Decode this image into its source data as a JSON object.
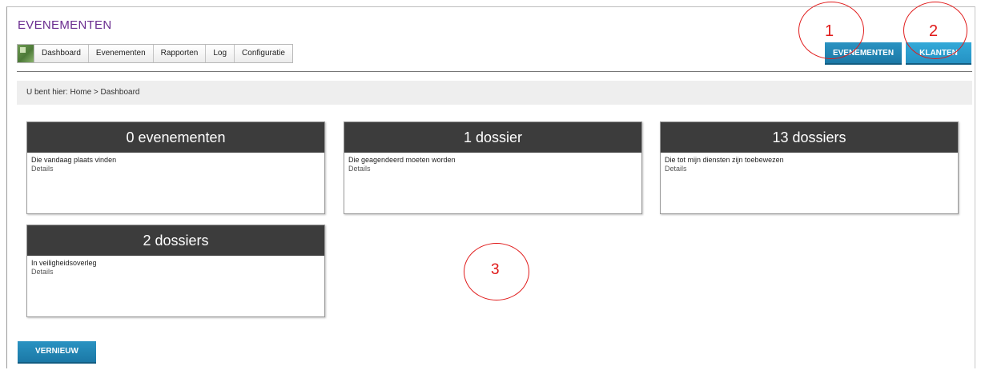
{
  "app_title": "EVENEMENTEN",
  "menu": {
    "items": [
      "Dashboard",
      "Evenementen",
      "Rapporten",
      "Log",
      "Configuratie"
    ]
  },
  "header_buttons": {
    "evenementen": "EVENEMENTEN",
    "klanten": "KLANTEN"
  },
  "breadcrumb": "U bent hier: Home > Dashboard",
  "cards": [
    {
      "title": "0 evenementen",
      "description": "Die vandaag plaats vinden",
      "link": "Details"
    },
    {
      "title": "1 dossier",
      "description": "Die geagendeerd moeten worden",
      "link": "Details"
    },
    {
      "title": "13 dossiers",
      "description": "Die tot mijn diensten zijn toebewezen",
      "link": "Details"
    },
    {
      "title": "2 dossiers",
      "description": "In veiligheidsoverleg",
      "link": "Details"
    }
  ],
  "refresh_button": "VERNIEUW",
  "annotations": [
    "1",
    "2",
    "3"
  ],
  "colors": {
    "title_purple": "#6a2c8f",
    "button_blue": "#1b78a6",
    "card_header": "#3c3c3c",
    "annotation_red": "#e01a1a"
  }
}
